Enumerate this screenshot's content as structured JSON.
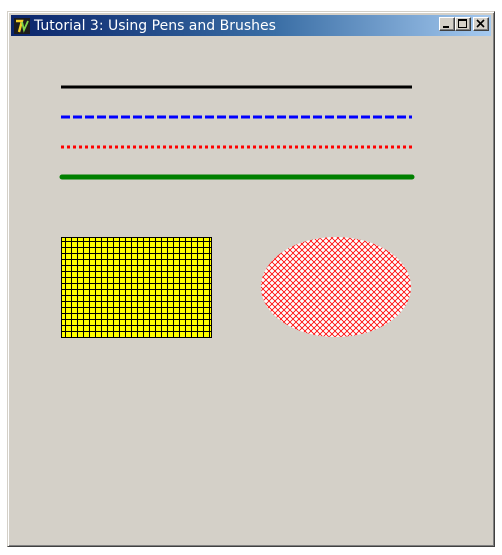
{
  "window": {
    "title": "Tutorial 3: Using Pens and Brushes",
    "app_icon": "qt-logo-icon",
    "buttons": [
      "minimize-icon",
      "maximize-icon",
      "close-icon"
    ]
  },
  "canvas": {
    "background": "#d4d0c8",
    "pens": [
      {
        "name": "solid",
        "color": "#000000",
        "style": "solid"
      },
      {
        "name": "dashed",
        "color": "#0000ff",
        "style": "dash"
      },
      {
        "name": "dotted",
        "color": "#ff0000",
        "style": "dot"
      },
      {
        "name": "thick",
        "color": "#008000",
        "style": "solid"
      }
    ],
    "brushes": [
      {
        "shape": "rectangle",
        "fill": "#ffff00",
        "pattern": "cross",
        "pattern_color": "#000000"
      },
      {
        "shape": "ellipse",
        "fill": "#ffffff",
        "pattern": "diagonal-cross",
        "pattern_color": "#ff0000"
      }
    ]
  }
}
